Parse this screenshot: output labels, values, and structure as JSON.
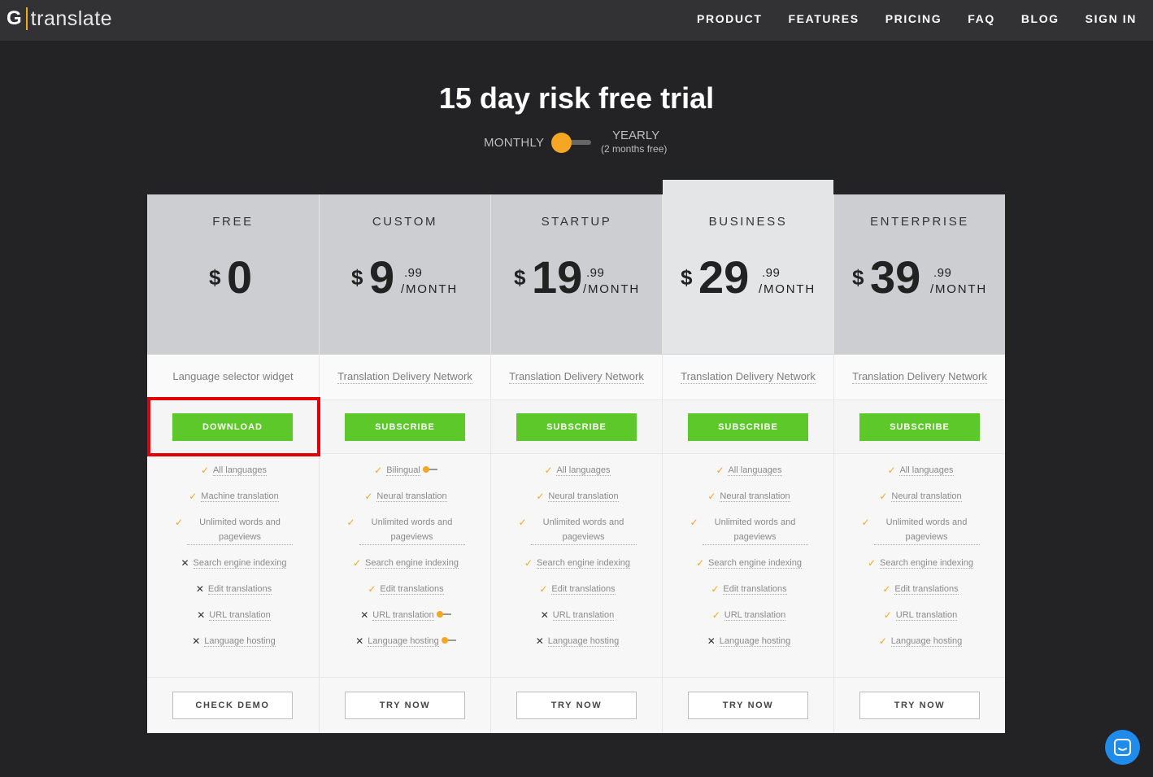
{
  "brand": {
    "letter": "G",
    "word": "translate",
    "accent": "#f5a623"
  },
  "nav": [
    "PRODUCT",
    "FEATURES",
    "PRICING",
    "FAQ",
    "BLOG",
    "SIGN IN"
  ],
  "headline": "15 day risk free trial",
  "billing": {
    "monthly": "MONTHLY",
    "yearly": "YEARLY",
    "yearly_note": "(2 months free)",
    "selected": "MONTHLY"
  },
  "plans": [
    {
      "name": "FREE",
      "currency": "$",
      "amount": "0",
      "cents": "",
      "per": "",
      "desc": "Language selector widget",
      "cta": "DOWNLOAD",
      "secondary": "CHECK DEMO",
      "features": [
        {
          "text": "All languages",
          "ok": true
        },
        {
          "text": "Machine translation",
          "ok": true
        },
        {
          "text": "Unlimited words and pageviews",
          "ok": true
        },
        {
          "text": "Search engine indexing",
          "ok": false
        },
        {
          "text": "Edit translations",
          "ok": false
        },
        {
          "text": "URL translation",
          "ok": false
        },
        {
          "text": "Language hosting",
          "ok": false
        }
      ]
    },
    {
      "name": "CUSTOM",
      "currency": "$",
      "amount": "9",
      "cents": ".99",
      "per": "/MONTH",
      "desc": "Translation Delivery Network",
      "cta": "SUBSCRIBE",
      "secondary": "TRY NOW",
      "features": [
        {
          "text": "Bilingual",
          "ok": true,
          "toggle": true
        },
        {
          "text": "Neural translation",
          "ok": true
        },
        {
          "text": "Unlimited words and pageviews",
          "ok": true
        },
        {
          "text": "Search engine indexing",
          "ok": true
        },
        {
          "text": "Edit translations",
          "ok": true
        },
        {
          "text": "URL translation",
          "ok": false,
          "toggle": true
        },
        {
          "text": "Language hosting",
          "ok": false,
          "toggle": true
        }
      ]
    },
    {
      "name": "STARTUP",
      "currency": "$",
      "amount": "19",
      "cents": ".99",
      "per": "/MONTH",
      "desc": "Translation Delivery Network",
      "cta": "SUBSCRIBE",
      "secondary": "TRY NOW",
      "features": [
        {
          "text": "All languages",
          "ok": true
        },
        {
          "text": "Neural translation",
          "ok": true
        },
        {
          "text": "Unlimited words and pageviews",
          "ok": true
        },
        {
          "text": "Search engine indexing",
          "ok": true
        },
        {
          "text": "Edit translations",
          "ok": true
        },
        {
          "text": "URL translation",
          "ok": false
        },
        {
          "text": "Language hosting",
          "ok": false
        }
      ]
    },
    {
      "name": "BUSINESS",
      "currency": "$",
      "amount": "29",
      "cents": ".99",
      "per": "/MONTH",
      "desc": "Translation Delivery Network",
      "cta": "SUBSCRIBE",
      "secondary": "TRY NOW",
      "featured": true,
      "features": [
        {
          "text": "All languages",
          "ok": true
        },
        {
          "text": "Neural translation",
          "ok": true
        },
        {
          "text": "Unlimited words and pageviews",
          "ok": true
        },
        {
          "text": "Search engine indexing",
          "ok": true
        },
        {
          "text": "Edit translations",
          "ok": true
        },
        {
          "text": "URL translation",
          "ok": true
        },
        {
          "text": "Language hosting",
          "ok": false
        }
      ]
    },
    {
      "name": "ENTERPRISE",
      "currency": "$",
      "amount": "39",
      "cents": ".99",
      "per": "/MONTH",
      "desc": "Translation Delivery Network",
      "cta": "SUBSCRIBE",
      "secondary": "TRY NOW",
      "features": [
        {
          "text": "All languages",
          "ok": true
        },
        {
          "text": "Neural translation",
          "ok": true
        },
        {
          "text": "Unlimited words and pageviews",
          "ok": true
        },
        {
          "text": "Search engine indexing",
          "ok": true
        },
        {
          "text": "Edit translations",
          "ok": true
        },
        {
          "text": "URL translation",
          "ok": true
        },
        {
          "text": "Language hosting",
          "ok": true
        }
      ]
    }
  ],
  "colors": {
    "cta": "#5cc82a",
    "check": "#f5a623",
    "highlight": "#e00000",
    "chat": "#1f8ceb"
  },
  "chat_icon": "chat-bubble-icon"
}
